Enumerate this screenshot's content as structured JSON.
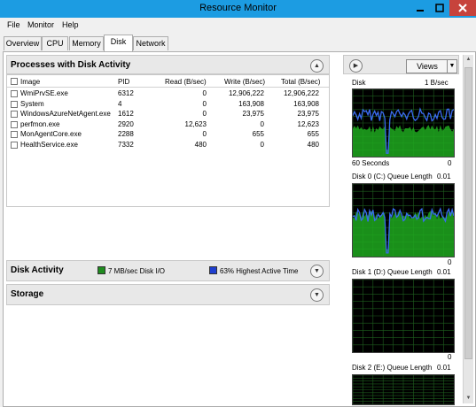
{
  "window": {
    "title": "Resource Monitor"
  },
  "menu": [
    "File",
    "Monitor",
    "Help"
  ],
  "tabs": [
    "Overview",
    "CPU",
    "Memory",
    "Disk",
    "Network"
  ],
  "processes": {
    "title": "Processes with Disk Activity",
    "columns": [
      "Image",
      "PID",
      "Read (B/sec)",
      "Write (B/sec)",
      "Total (B/sec)"
    ],
    "rows": [
      {
        "image": "WmiPrvSE.exe",
        "pid": "6312",
        "read": "0",
        "write": "12,906,222",
        "total": "12,906,222"
      },
      {
        "image": "System",
        "pid": "4",
        "read": "0",
        "write": "163,908",
        "total": "163,908"
      },
      {
        "image": "WindowsAzureNetAgent.exe",
        "pid": "1612",
        "read": "0",
        "write": "23,975",
        "total": "23,975"
      },
      {
        "image": "perfmon.exe",
        "pid": "2920",
        "read": "12,623",
        "write": "0",
        "total": "12,623"
      },
      {
        "image": "MonAgentCore.exe",
        "pid": "2288",
        "read": "0",
        "write": "655",
        "total": "655"
      },
      {
        "image": "HealthService.exe",
        "pid": "7332",
        "read": "480",
        "write": "0",
        "total": "480"
      }
    ]
  },
  "disk_activity": {
    "title": "Disk Activity",
    "io_label": "7 MB/sec Disk I/O",
    "active_label": "63% Highest Active Time",
    "io_color": "#1f8c1f",
    "active_color": "#1f3fd0"
  },
  "storage": {
    "title": "Storage"
  },
  "right": {
    "views_label": "Views",
    "graphs": [
      {
        "name": "Disk",
        "scale": "1 B/sec",
        "bottom_left": "60 Seconds",
        "bottom_right": "0"
      },
      {
        "name": "Disk 0 (C:) Queue Length",
        "scale": "0.01",
        "bottom_left": "",
        "bottom_right": "0"
      },
      {
        "name": "Disk 1 (D:) Queue Length",
        "scale": "0.01",
        "bottom_left": "",
        "bottom_right": "0"
      },
      {
        "name": "Disk 2 (E:) Queue Length",
        "scale": "0.01",
        "bottom_left": "",
        "bottom_right": ""
      }
    ]
  },
  "colors": {
    "titlebar": "#1c9ce2",
    "close": "#c7433c",
    "graph_green": "#1fa81f",
    "graph_blue": "#3a6cf0"
  }
}
